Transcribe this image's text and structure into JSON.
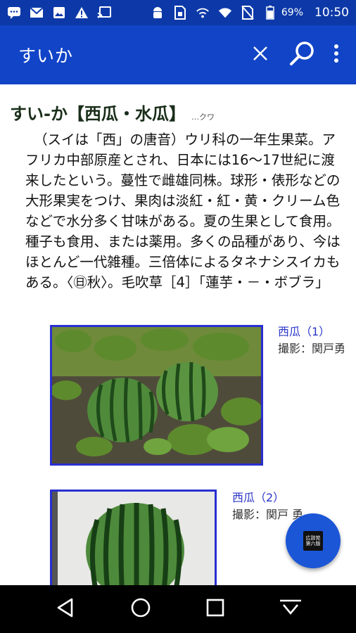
{
  "status_bar": {
    "battery_percent": "69%",
    "time": "10:50",
    "icons": [
      "chat-icon",
      "gmail-icon",
      "image-icon",
      "warning-icon",
      "cast-icon",
      "android-icon",
      "sim-icon",
      "wifi-calling-icon",
      "wifi-icon",
      "no-sim-icon",
      "battery-icon"
    ]
  },
  "app_bar": {
    "query": "すいか",
    "icons": [
      "close-icon",
      "search-icon",
      "more-vert-icon"
    ]
  },
  "entry": {
    "headword": "すい-か【西瓜・水瓜】",
    "reading": "…クワ",
    "definition": "（スイは「西」の唐音）ウリ科の一年生果菜。アフリカ中部原産とされ、日本には16〜17世紀に渡来したという。蔓性で雌雄同株。球形・俵形などの大形果実をつけ、果肉は淡紅・紅・黄・クリーム色などで水分多く甘味がある。夏の生果として食用。種子も食用、または薬用。多くの品種があり、今はほとんど一代雑種。三倍体によるタネナシスイカもある。〈㊐秋〉。毛吹草［4］「蓮芋・－・ボブラ」"
  },
  "figures": [
    {
      "title": "西瓜（1）",
      "credit": "撮影：関戸勇"
    },
    {
      "title": "西瓜（2）",
      "credit": "撮影：関戸 勇"
    }
  ],
  "fab": {
    "line1": "広辞苑",
    "line2": "第六版"
  },
  "nav_bar": {
    "icons": [
      "back-icon",
      "home-icon",
      "recents-icon",
      "keyboard-hide-icon"
    ]
  },
  "colors": {
    "status_bar": "#0d39a8",
    "app_bar": "#1144c7",
    "fab": "#1b56d6",
    "link": "#2a34c8"
  }
}
